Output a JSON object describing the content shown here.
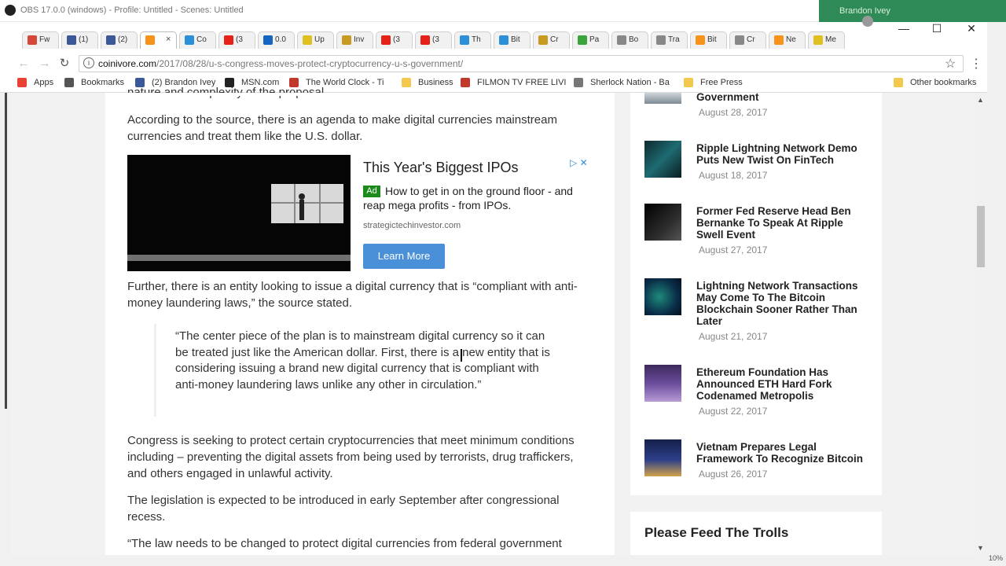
{
  "obs": {
    "title": "OBS 17.0.0 (windows) - Profile: Untitled - Scenes: Untitled"
  },
  "background_window": {
    "text": "Brandon Ivey"
  },
  "tabs": [
    {
      "label": "Fw",
      "icon": "gmail-icon",
      "color": "#d44638"
    },
    {
      "label": "(1)",
      "icon": "facebook-icon",
      "color": "#3b5998"
    },
    {
      "label": "(2)",
      "icon": "facebook-icon",
      "color": "#3b5998"
    },
    {
      "label": "",
      "icon": "coinivore-icon",
      "color": "#f7931a",
      "active": true
    },
    {
      "label": "Co",
      "icon": "generic-icon",
      "color": "#2b8fd8"
    },
    {
      "label": "(3",
      "icon": "youtube-icon",
      "color": "#e62117"
    },
    {
      "label": "0.0",
      "icon": "xapo-icon",
      "color": "#1565c0"
    },
    {
      "label": "Up",
      "icon": "upwork-icon",
      "color": "#e0c020"
    },
    {
      "label": "Inv",
      "icon": "investing-icon",
      "color": "#c89a20"
    },
    {
      "label": "(3",
      "icon": "youtube-icon",
      "color": "#e62117"
    },
    {
      "label": "(3",
      "icon": "youtube-icon",
      "color": "#e62117"
    },
    {
      "label": "Th",
      "icon": "coinmarket-icon",
      "color": "#2b8fd8"
    },
    {
      "label": "Bit",
      "icon": "coinmarket-icon",
      "color": "#2b8fd8"
    },
    {
      "label": "Cr",
      "icon": "crypto-icon",
      "color": "#c89a20"
    },
    {
      "label": "Pa",
      "icon": "leaf-icon",
      "color": "#3aa33a"
    },
    {
      "label": "Bo",
      "icon": "document-icon",
      "color": "#888888"
    },
    {
      "label": "Tra",
      "icon": "trade-icon",
      "color": "#888888"
    },
    {
      "label": "Bit",
      "icon": "bitcoin-icon",
      "color": "#f7931a"
    },
    {
      "label": "Cr",
      "icon": "document-icon",
      "color": "#888888"
    },
    {
      "label": "Ne",
      "icon": "coinivore-icon",
      "color": "#f7931a"
    },
    {
      "label": "Me",
      "icon": "document-icon",
      "color": "#e0c020"
    }
  ],
  "tab_close_glyph": "×",
  "window": {
    "minimize": "—",
    "maximize": "☐",
    "close": "✕"
  },
  "nav": {
    "back": "←",
    "forward": "→",
    "reload": "↻"
  },
  "address": {
    "domain": "coinivore.com",
    "path": "/2017/08/28/u-s-congress-moves-protect-cryptocurrency-u-s-government/",
    "info": "i",
    "star": "☆",
    "menu": "⋮"
  },
  "bookmarks": [
    {
      "label": "Apps",
      "icon": "apps-icon",
      "color": "#e94235"
    },
    {
      "label": "Bookmarks",
      "icon": "star-icon",
      "color": "#555555"
    },
    {
      "label": "(2) Brandon Ivey",
      "icon": "facebook-icon",
      "color": "#3b5998"
    },
    {
      "label": "MSN.com",
      "icon": "msn-icon",
      "color": "#222222"
    },
    {
      "label": "The World Clock - Ti",
      "icon": "clock-icon",
      "color": "#c0392b"
    },
    {
      "label": "Business",
      "icon": "folder-icon",
      "color": "#f2c94c"
    },
    {
      "label": "FILMON TV FREE LIVI",
      "icon": "filmon-icon",
      "color": "#c0392b"
    },
    {
      "label": "Sherlock Nation - Ba",
      "icon": "document-icon",
      "color": "#777777"
    },
    {
      "label": "Free Press",
      "icon": "folder-icon",
      "color": "#f2c94c"
    },
    {
      "label": "Other bookmarks",
      "icon": "folder-icon",
      "color": "#f2c94c"
    }
  ],
  "article": {
    "top_fragment": "nature and complexity of the proposal.",
    "p1": "According to the source, there is an agenda to make digital currencies mainstream currencies and treat them like the U.S. dollar.",
    "p2": "Further, there is an entity looking to issue a digital currency that is “compliant with anti-money laundering laws,” the source stated.",
    "quote": "“The center piece of the plan is to mainstream digital currency so it can be treated just like the American dollar. First, there is a new entity that is considering issuing a brand new digital currency that is compliant with anti-money laundering laws unlike any other in circulation.”",
    "p3": "Congress is seeking to protect certain cryptocurrencies that meet minimum conditions including – preventing the digital assets from being used by terrorists, drug traffickers, and others engaged in unlawful activity.",
    "p4": "The legislation is expected to be introduced in early September after congressional recess.",
    "p5": "“The law needs to be changed to protect digital currencies from federal government harassment to make sure that a compliant currency can be backed by"
  },
  "ad": {
    "title": "This Year's Biggest IPOs",
    "badge": "Ad",
    "body": "How to get in on the ground floor - and reap mega profits - from IPOs.",
    "url": "strategictechinvestor.com",
    "button": "Learn More",
    "choice": "▷ ✕"
  },
  "sidebar": {
    "items": [
      {
        "title": "Government",
        "date": "August 28, 2017"
      },
      {
        "title": "Ripple Lightning Network Demo Puts New Twist On FinTech",
        "date": "August 18, 2017"
      },
      {
        "title": "Former Fed Reserve Head Ben Bernanke To Speak At Ripple Swell Event",
        "date": "August 27, 2017"
      },
      {
        "title": "Lightning Network Transactions May Come To The Bitcoin Blockchain Sooner Rather Than Later",
        "date": "August 21, 2017"
      },
      {
        "title": "Ethereum Foundation Has Announced ETH Hard Fork Codenamed Metropolis",
        "date": "August 22, 2017"
      },
      {
        "title": "Vietnam Prepares Legal Framework To Recognize Bitcoin",
        "date": "August 26, 2017"
      }
    ],
    "widget_title": "Please Feed The Trolls"
  },
  "scroll": {
    "up": "▲",
    "down": "▼"
  },
  "status": {
    "zoom": "10%"
  }
}
